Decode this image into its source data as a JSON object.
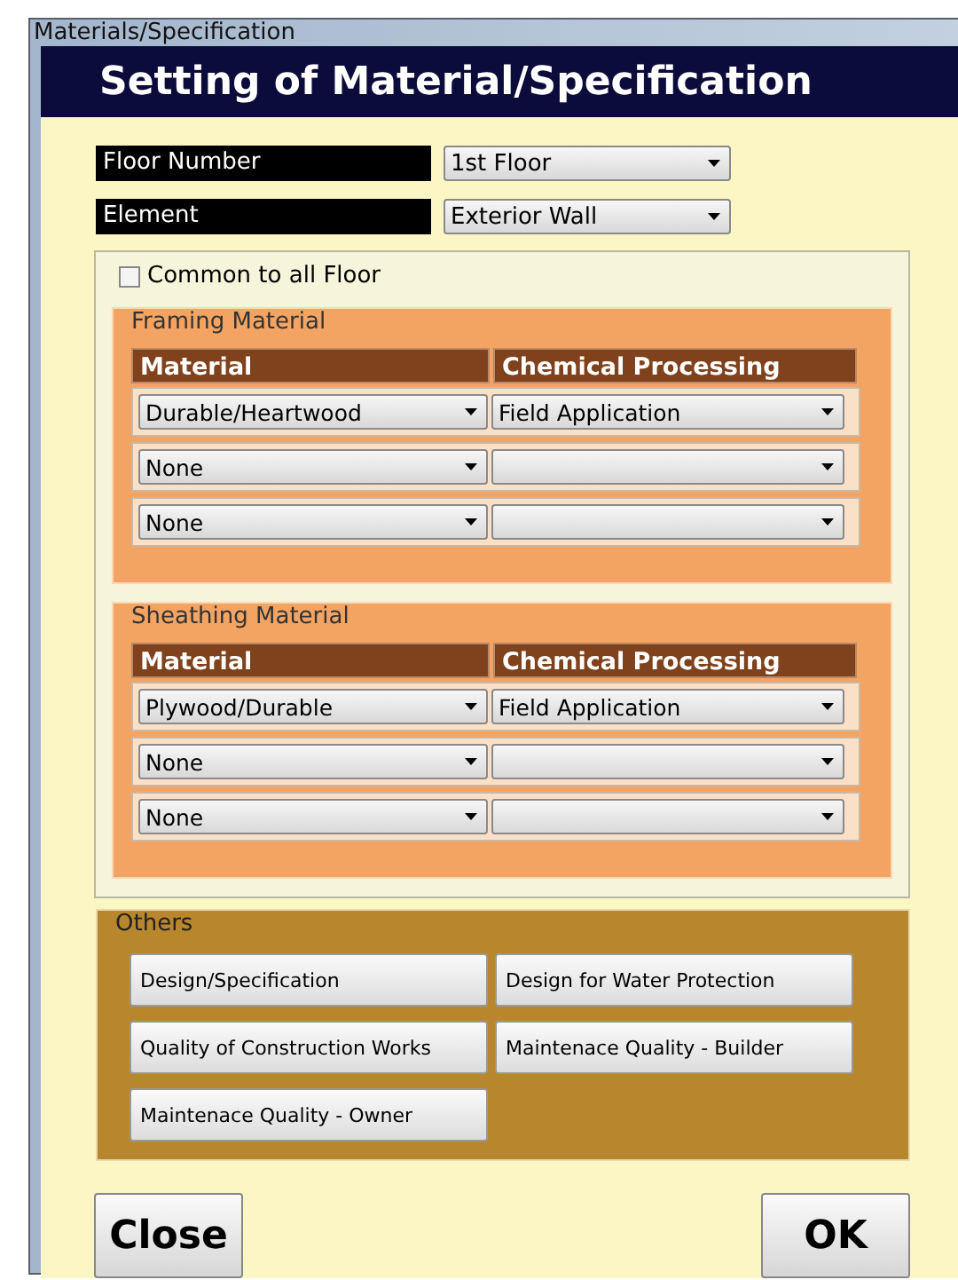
{
  "window": {
    "title": "Materials/Specification"
  },
  "header": "Setting of Material/Specification",
  "fields": [
    {
      "label": "Floor Number",
      "value": "1st Floor"
    },
    {
      "label": "Element",
      "value": "Exterior Wall"
    }
  ],
  "common_to_all_floor": {
    "label": "Common to all Floor",
    "checked": false
  },
  "groups": [
    {
      "title": "Framing Material",
      "columns": [
        "Material",
        "Chemical Processing"
      ],
      "rows": [
        {
          "material": "Durable/Heartwood",
          "processing": "Field Application"
        },
        {
          "material": "None"
        },
        {
          "material": "None"
        }
      ]
    },
    {
      "title": "Sheathing Material",
      "columns": [
        "Material",
        "Chemical Processing"
      ],
      "rows": [
        {
          "material": "Plywood/Durable",
          "processing": "Field Application"
        },
        {
          "material": "None"
        },
        {
          "material": "None"
        }
      ]
    }
  ],
  "others": {
    "title": "Others",
    "buttons": [
      "Design/Specification",
      "Design for Water Protection",
      "Quality of Construction Works",
      "Maintenace Quality - Builder",
      "Maintenace Quality - Owner"
    ]
  },
  "buttons": [
    "Close",
    "OK"
  ]
}
